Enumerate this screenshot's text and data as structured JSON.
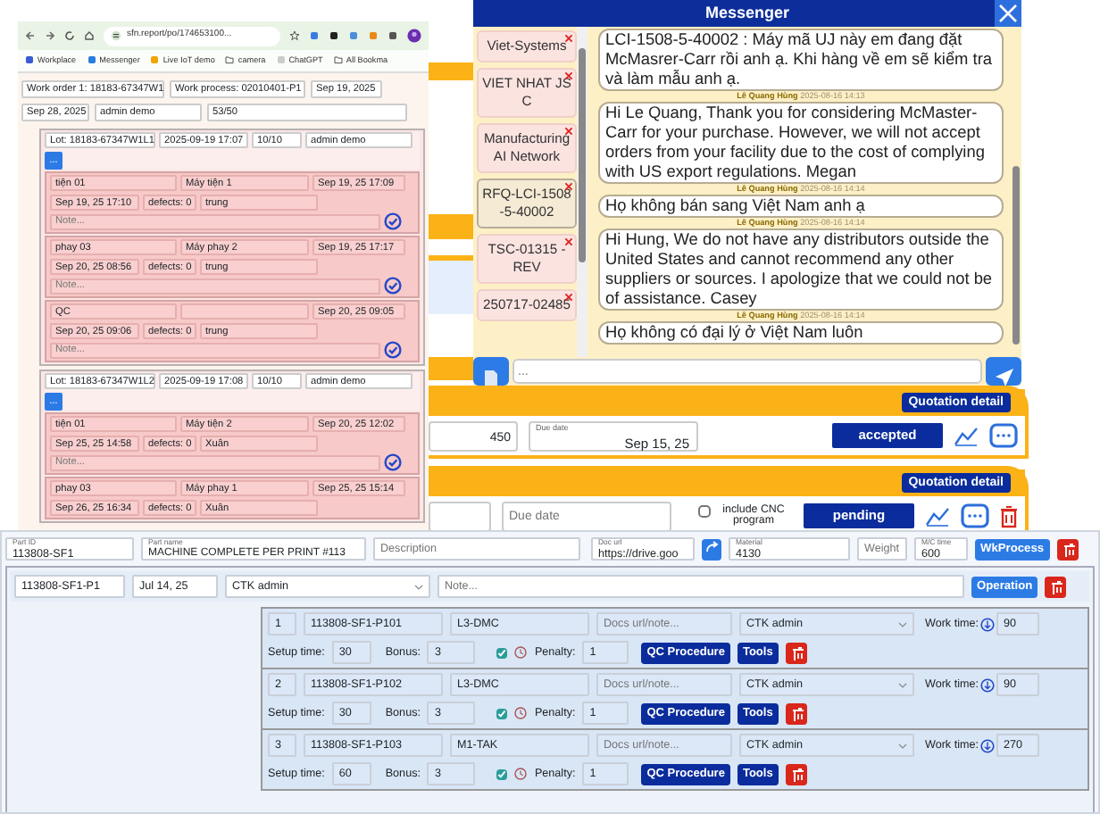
{
  "browser": {
    "url": "sfn.report/po/174653100...",
    "bookmarks": [
      "Workplace",
      "Messenger",
      "Live IoT demo",
      "camera",
      "ChatGPT",
      "All Bookma"
    ]
  },
  "work_order": {
    "fields": [
      "Work order 1: 18183-67347W1",
      "Work process: 02010401-P1",
      "Sep 19, 2025",
      "Sep 28, 2025",
      "admin demo",
      "53/50"
    ]
  },
  "lots": [
    {
      "fields": [
        "Lot: 18183-67347W1L1",
        "2025-09-19 17:07",
        "10/10",
        "admin demo"
      ],
      "more_button": "...",
      "steps": [
        {
          "operation": "tiện 01",
          "machine": "Máy tiện 1",
          "start": "Sep 19, 25 17:09",
          "end": "Sep 19, 25 17:10",
          "defects": "defects: 0",
          "worker": "trung",
          "note_placeholder": "Note..."
        },
        {
          "operation": "phay 03",
          "machine": "Máy phay 2",
          "start": "Sep 19, 25 17:17",
          "end": "Sep 20, 25 08:56",
          "defects": "defects: 0",
          "worker": "trung",
          "note_placeholder": "Note..."
        },
        {
          "operation": "QC",
          "start": "Sep 20, 25 09:05",
          "end": "Sep 20, 25 09:06",
          "defects": "defects: 0",
          "worker": "trung",
          "note_placeholder": "Note..."
        }
      ]
    },
    {
      "fields": [
        "Lot: 18183-67347W1L2",
        "2025-09-19 17:08",
        "10/10",
        "admin demo"
      ],
      "more_button": "...",
      "steps": [
        {
          "operation": "tiện 01",
          "machine": "Máy tiện 2",
          "start": "Sep 20, 25 12:02",
          "end": "Sep 25, 25 14:58",
          "defects": "defects: 0",
          "worker": "Xuân",
          "note_placeholder": "Note..."
        },
        {
          "operation": "phay 03",
          "machine": "Máy phay 1",
          "start": "Sep 25, 25 15:14",
          "end": "Sep 26, 25 16:34",
          "defects": "defects: 0",
          "worker": "Xuân"
        }
      ]
    }
  ],
  "messenger": {
    "title": "Messenger",
    "contacts": [
      {
        "name": "Viet-Systems",
        "selected": false
      },
      {
        "name": "VIET NHAT JSC",
        "selected": false
      },
      {
        "name": "Manufacturing AI Network",
        "selected": false
      },
      {
        "name": "RFQ-LCI-1508-5-40002",
        "selected": true
      },
      {
        "name": "TSC-01315 - REV",
        "selected": false
      },
      {
        "name": "250717-02485",
        "selected": false
      }
    ],
    "messages": [
      {
        "text": "LCI-1508-5-40002 : Máy mã UJ này em đang đặt McMasrer-Carr rồi anh ạ. Khi hàng về em sẽ kiểm tra và làm mẫu anh ạ."
      },
      {
        "author": "Lê Quang Hùng",
        "time": "2025-08-16 14:13",
        "text": "Hi Le Quang,   Thank you for considering McMaster-Carr for your purchase. However, we will not accept orders from your facility due to the cost of complying with US export regulations. Megan"
      },
      {
        "author": "Lê Quang Hùng",
        "time": "2025-08-16 14:14",
        "text": "Họ không bán sang Việt Nam anh ạ"
      },
      {
        "author": "Lê Quang Hùng",
        "time": "2025-08-16 14:14",
        "text": "Hi Hung,   We do not have any distributors outside the United States and cannot recommend any other suppliers or sources.    I apologize that we could not be of assistance.    Casey"
      },
      {
        "author": "Lê Quang Hùng",
        "time": "2025-08-16 14:14",
        "text": "Họ không có đại lý ở Việt Nam luôn"
      }
    ],
    "input_placeholder": "..."
  },
  "quotations": [
    {
      "detail_button": "Quotation detail",
      "quantity": "450",
      "due_label": "Due date",
      "due_date": "Sep 15, 25",
      "status": "accepted",
      "deletable": false
    },
    {
      "detail_button": "Quotation detail",
      "due_placeholder": "Due date",
      "cnc_label": "include CNC program",
      "cnc_checked": false,
      "status": "pending",
      "deletable": true
    }
  ],
  "part": {
    "id_label": "Part ID",
    "id": "113808-SF1",
    "name_label": "Part name",
    "name": "MACHINE COMPLETE PER PRINT #113",
    "description_placeholder": "Description",
    "doc_label": "Doc url",
    "doc_url": "https://drive.goo",
    "material_label": "Material",
    "material": "4130",
    "weight_placeholder": "Weight",
    "mc_label": "M/C time",
    "mc_time": "600",
    "button": "WkProcess"
  },
  "process": {
    "id": "113808-SF1-P1",
    "date": "Jul 14, 25",
    "assignee": "CTK admin",
    "note_placeholder": "Note...",
    "button": "Operation"
  },
  "operations": [
    {
      "no": "1",
      "code": "113808-SF1-P101",
      "machine": "L3-DMC",
      "docs_placeholder": "Docs url/note...",
      "assignee": "CTK admin",
      "work_label": "Work time:",
      "work_time": "90",
      "setup_label": "Setup time:",
      "setup_time": "30",
      "bonus_label": "Bonus:",
      "bonus": "3",
      "bonus_checked": true,
      "penalty_label": "Penalty:",
      "penalty": "1",
      "qc_button": "QC Procedure",
      "tools_button": "Tools"
    },
    {
      "no": "2",
      "code": "113808-SF1-P102",
      "machine": "L3-DMC",
      "docs_placeholder": "Docs url/note...",
      "assignee": "CTK admin",
      "work_label": "Work time:",
      "work_time": "90",
      "setup_label": "Setup time:",
      "setup_time": "30",
      "bonus_label": "Bonus:",
      "bonus": "3",
      "bonus_checked": true,
      "penalty_label": "Penalty:",
      "penalty": "1",
      "qc_button": "QC Procedure",
      "tools_button": "Tools"
    },
    {
      "no": "3",
      "code": "113808-SF1-P103",
      "machine": "M1-TAK",
      "docs_placeholder": "Docs url/note...",
      "assignee": "CTK admin",
      "work_label": "Work time:",
      "work_time": "270",
      "setup_label": "Setup time:",
      "setup_time": "60",
      "bonus_label": "Bonus:",
      "bonus": "3",
      "bonus_checked": true,
      "penalty_label": "Penalty:",
      "penalty": "1",
      "qc_button": "QC Procedure",
      "tools_button": "Tools"
    }
  ]
}
